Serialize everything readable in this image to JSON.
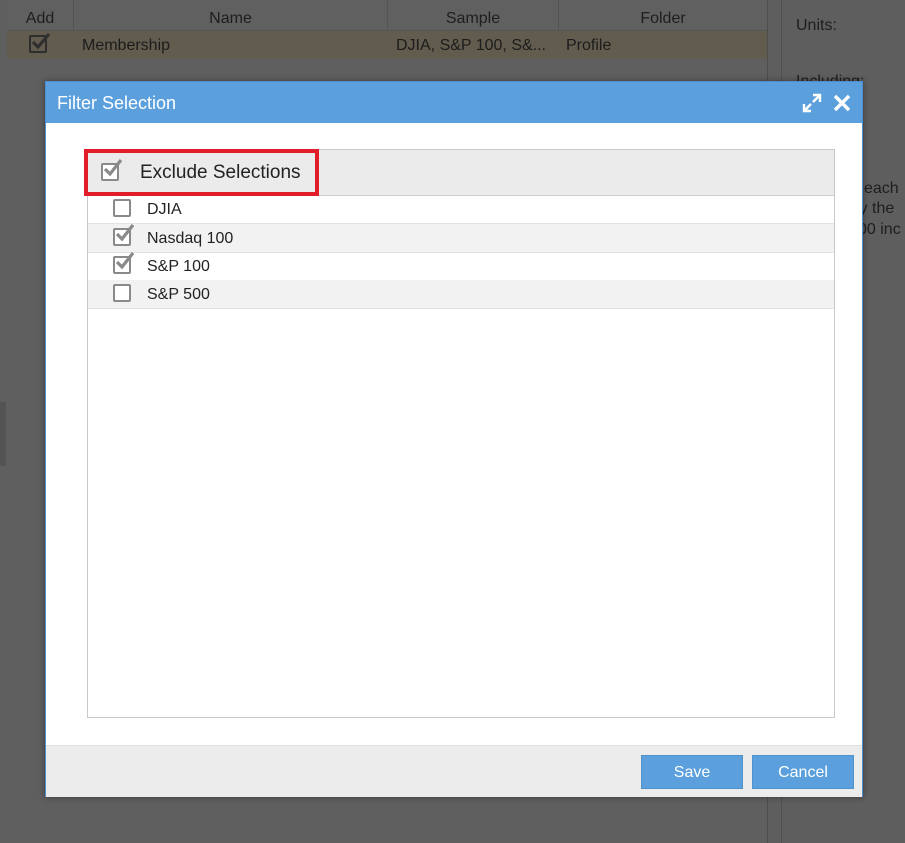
{
  "background": {
    "table": {
      "headers": [
        "Add",
        "Name",
        "Sample",
        "Folder"
      ],
      "row": {
        "name": "Membership",
        "sample": "DJIA, S&P 100, S&...",
        "folder": "Profile",
        "checked": true
      }
    },
    "right_panel": {
      "units_label": "Units:",
      "including_label": "Including:",
      "text_fragments": [
        "each",
        "ly the",
        "00 inc"
      ]
    }
  },
  "modal": {
    "title": "Filter Selection",
    "expand_icon": "expand-icon",
    "close_icon": "close-icon",
    "exclude_selections": {
      "label": "Exclude Selections",
      "checked": true
    },
    "items": [
      {
        "label": "DJIA",
        "checked": false
      },
      {
        "label": "Nasdaq 100",
        "checked": true
      },
      {
        "label": "S&P 100",
        "checked": true
      },
      {
        "label": "S&P 500",
        "checked": false
      }
    ],
    "footer": {
      "save_label": "Save",
      "cancel_label": "Cancel"
    }
  },
  "colors": {
    "accent": "#5ba0dd",
    "highlight_border": "#e21d2a",
    "overlay": "#5e5e5e"
  }
}
